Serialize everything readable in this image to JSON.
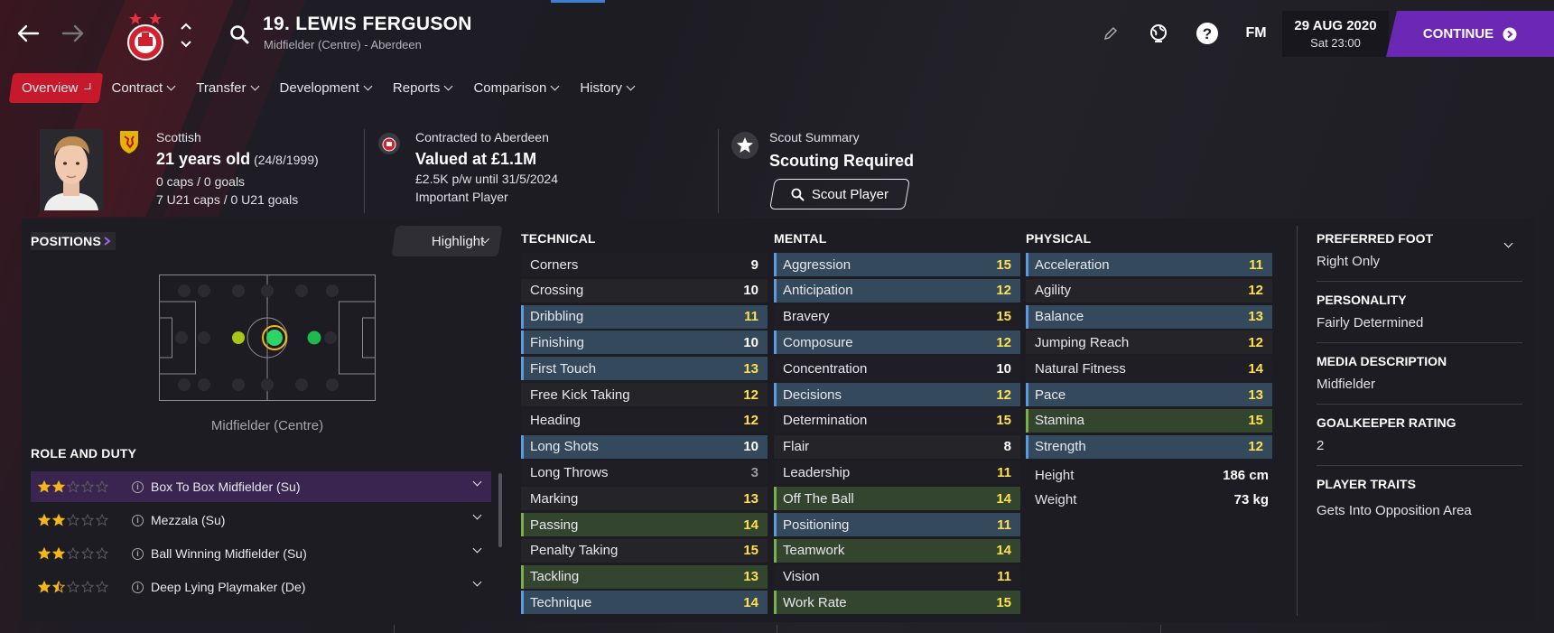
{
  "header": {
    "player_title": "19. LEWIS FERGUSON",
    "player_subtitle": "Midfielder (Centre) - Aberdeen",
    "date": "29 AUG 2020",
    "time": "Sat 23:00",
    "fm_label": "FM",
    "continue_label": "CONTINUE"
  },
  "tabs": [
    {
      "label": "Overview"
    },
    {
      "label": "Contract"
    },
    {
      "label": "Transfer"
    },
    {
      "label": "Development"
    },
    {
      "label": "Reports"
    },
    {
      "label": "Comparison"
    },
    {
      "label": "History"
    }
  ],
  "bio": {
    "nationality": "Scottish",
    "age": "21 years old",
    "dob": "(24/8/1999)",
    "caps": "0 caps / 0 goals",
    "u21_caps": "7 U21 caps / 0 U21 goals"
  },
  "contract": {
    "label": "Contracted to Aberdeen",
    "value": "Valued at £1.1M",
    "wage": "£2.5K p/w until 31/5/2024",
    "status": "Important Player"
  },
  "scout": {
    "label": "Scout Summary",
    "status": "Scouting Required",
    "button": "Scout Player"
  },
  "positions": {
    "label": "POSITIONS",
    "highlight_label": "Highlight",
    "position_name": "Midfielder (Centre)"
  },
  "roles": {
    "label": "ROLE AND DUTY",
    "items": [
      {
        "name": "Box To Box Midfielder (Su)",
        "stars": 2
      },
      {
        "name": "Mezzala (Su)",
        "stars": 2
      },
      {
        "name": "Ball Winning Midfielder (Su)",
        "stars": 2
      },
      {
        "name": "Deep Lying Playmaker (De)",
        "stars": 1.5
      }
    ]
  },
  "technical": {
    "label": "TECHNICAL",
    "attrs": [
      {
        "name": "Corners",
        "value": "9"
      },
      {
        "name": "Crossing",
        "value": "10"
      },
      {
        "name": "Dribbling",
        "value": "11"
      },
      {
        "name": "Finishing",
        "value": "10"
      },
      {
        "name": "First Touch",
        "value": "13"
      },
      {
        "name": "Free Kick Taking",
        "value": "12"
      },
      {
        "name": "Heading",
        "value": "12"
      },
      {
        "name": "Long Shots",
        "value": "10"
      },
      {
        "name": "Long Throws",
        "value": "3"
      },
      {
        "name": "Marking",
        "value": "13"
      },
      {
        "name": "Passing",
        "value": "14"
      },
      {
        "name": "Penalty Taking",
        "value": "15"
      },
      {
        "name": "Tackling",
        "value": "13"
      },
      {
        "name": "Technique",
        "value": "14"
      }
    ]
  },
  "mental": {
    "label": "MENTAL",
    "attrs": [
      {
        "name": "Aggression",
        "value": "15"
      },
      {
        "name": "Anticipation",
        "value": "12"
      },
      {
        "name": "Bravery",
        "value": "15"
      },
      {
        "name": "Composure",
        "value": "12"
      },
      {
        "name": "Concentration",
        "value": "10"
      },
      {
        "name": "Decisions",
        "value": "12"
      },
      {
        "name": "Determination",
        "value": "15"
      },
      {
        "name": "Flair",
        "value": "8"
      },
      {
        "name": "Leadership",
        "value": "11"
      },
      {
        "name": "Off The Ball",
        "value": "14"
      },
      {
        "name": "Positioning",
        "value": "11"
      },
      {
        "name": "Teamwork",
        "value": "14"
      },
      {
        "name": "Vision",
        "value": "11"
      },
      {
        "name": "Work Rate",
        "value": "15"
      }
    ]
  },
  "physical": {
    "label": "PHYSICAL",
    "attrs": [
      {
        "name": "Acceleration",
        "value": "11"
      },
      {
        "name": "Agility",
        "value": "12"
      },
      {
        "name": "Balance",
        "value": "13"
      },
      {
        "name": "Jumping Reach",
        "value": "12"
      },
      {
        "name": "Natural Fitness",
        "value": "14"
      },
      {
        "name": "Pace",
        "value": "13"
      },
      {
        "name": "Stamina",
        "value": "15"
      },
      {
        "name": "Strength",
        "value": "12"
      }
    ],
    "height_label": "Height",
    "height": "186 cm",
    "weight_label": "Weight",
    "weight": "73 kg"
  },
  "details": {
    "foot_label": "PREFERRED FOOT",
    "foot": "Right Only",
    "personality_label": "PERSONALITY",
    "personality": "Fairly Determined",
    "media_label": "MEDIA DESCRIPTION",
    "media": "Midfielder",
    "gk_label": "GOALKEEPER RATING",
    "gk": "2",
    "traits_label": "PLAYER TRAITS",
    "traits": "Gets Into Opposition Area"
  },
  "colors": {
    "accent_red": "#c6192c",
    "continue_purple": "#6a28b4",
    "value_yellow": "#ffe14a"
  }
}
